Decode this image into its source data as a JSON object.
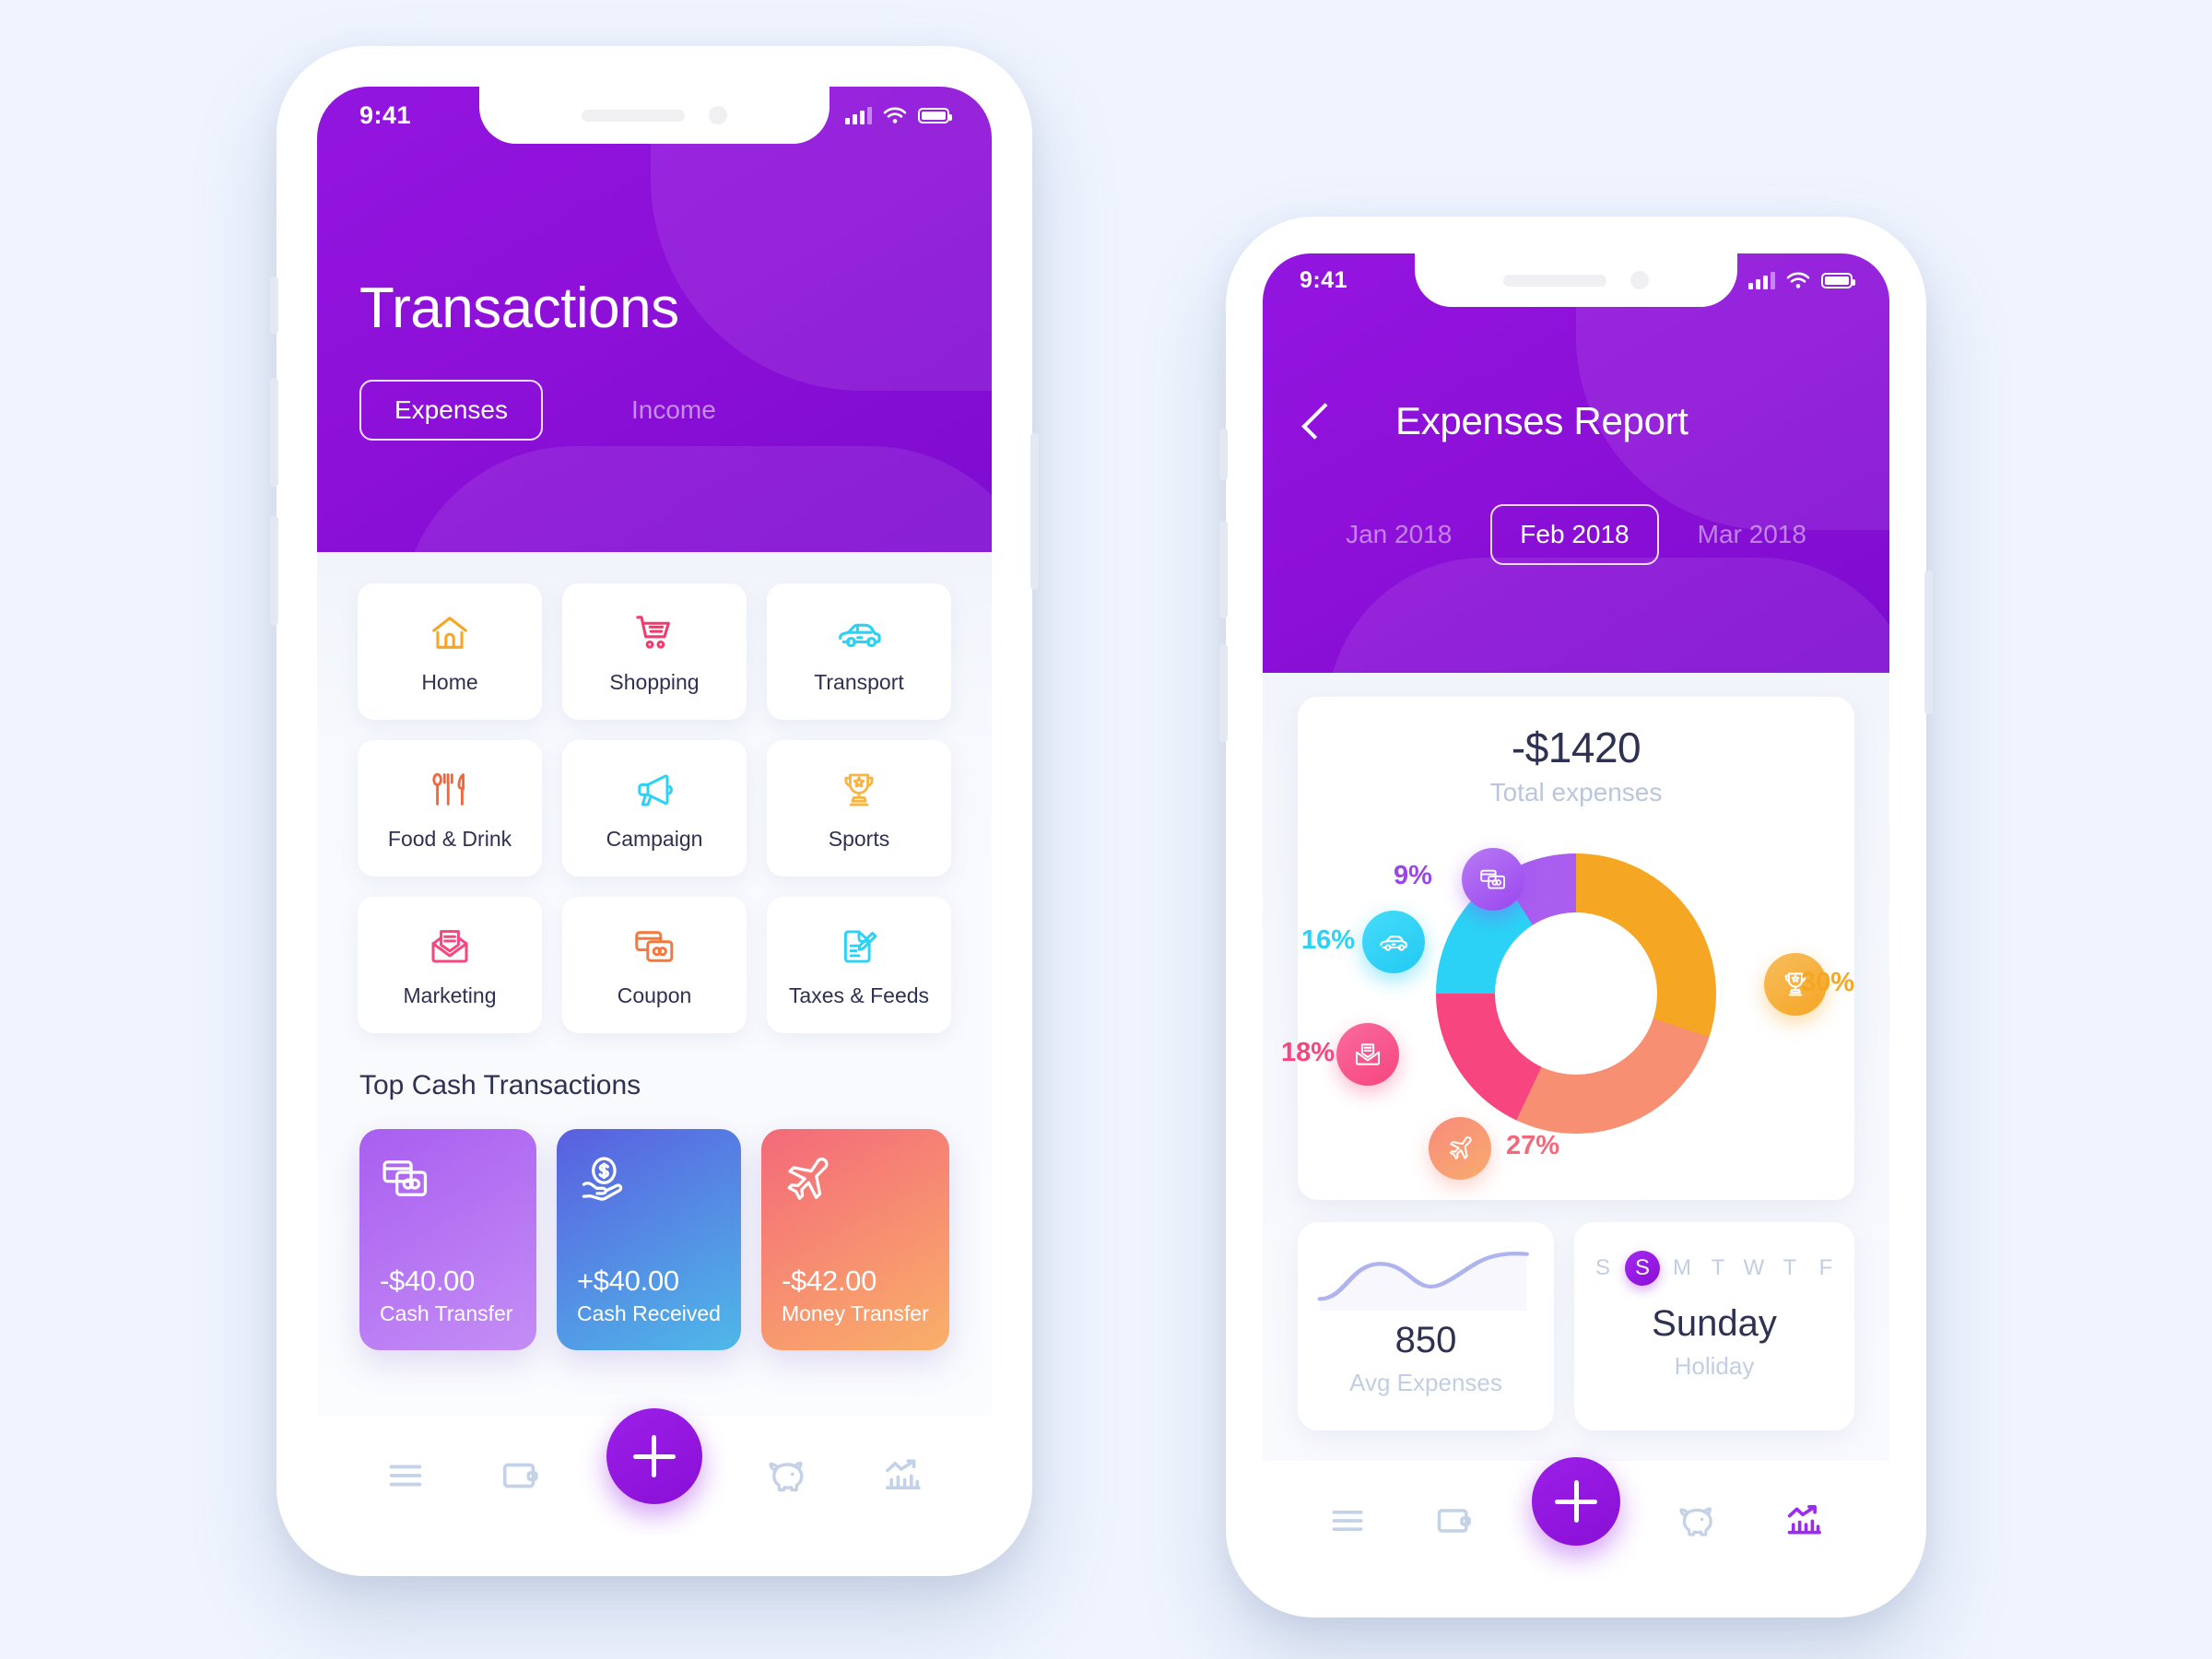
{
  "background_color": "#eff4fe",
  "brand": {
    "purple": "#8a0fd6",
    "purple_light": "#a428ef",
    "text_dark": "#2e3151",
    "text_muted": "#b9c6dd"
  },
  "phone_transactions": {
    "status_bar": {
      "time": "9:41",
      "signal_icon": "signal-bars-icon",
      "wifi_icon": "wifi-icon",
      "battery_icon": "battery-icon"
    },
    "header": {
      "title": "Transactions",
      "tabs": [
        {
          "label": "Expenses",
          "selected": true
        },
        {
          "label": "Income",
          "selected": false
        }
      ]
    },
    "categories": [
      {
        "label": "Home",
        "icon": "house-icon",
        "color": "#f5a623"
      },
      {
        "label": "Shopping",
        "icon": "shopping-cart-icon",
        "color": "#f7386f"
      },
      {
        "label": "Transport",
        "icon": "car-icon",
        "color": "#2bd2f5"
      },
      {
        "label": "Food & Drink",
        "icon": "cutlery-icon",
        "color": "#f4663c"
      },
      {
        "label": "Campaign",
        "icon": "megaphone-icon",
        "color": "#2bd2f5"
      },
      {
        "label": "Sports",
        "icon": "trophy-icon",
        "color": "#f7b548"
      },
      {
        "label": "Marketing",
        "icon": "envelope-icon",
        "color": "#f7457f"
      },
      {
        "label": "Coupon",
        "icon": "credit-cards-icon",
        "color": "#f4783c"
      },
      {
        "label": "Taxes & Feeds",
        "icon": "document-edit-icon",
        "color": "#2bd2f5"
      }
    ],
    "section_title": "Top Cash Transactions",
    "transactions": [
      {
        "amount": "-$40.00",
        "label": "Cash Transfer",
        "icon": "credit-cards-icon",
        "gradient_from": "#a95ef0",
        "gradient_to": "#c48ef5"
      },
      {
        "amount": "+$40.00",
        "label": "Cash Received",
        "icon": "money-hand-icon",
        "gradient_from": "#5a5ee0",
        "gradient_to": "#4fb9e8"
      },
      {
        "amount": "-$42.00",
        "label": "Money Transfer",
        "icon": "airplane-icon",
        "gradient_from": "#f4697a",
        "gradient_to": "#f9b069"
      }
    ],
    "tab_bar": {
      "items": [
        {
          "icon": "menu-icon",
          "active": false
        },
        {
          "icon": "wallet-icon",
          "active": false
        },
        {
          "icon": "plus-icon",
          "active": false,
          "is_fab": true
        },
        {
          "icon": "piggy-bank-icon",
          "active": false
        },
        {
          "icon": "chart-growth-icon",
          "active": false
        }
      ]
    }
  },
  "phone_report": {
    "status_bar": {
      "time": "9:41",
      "signal_icon": "signal-bars-icon",
      "wifi_icon": "wifi-icon",
      "battery_icon": "battery-icon"
    },
    "header": {
      "back_icon": "chevron-left-icon",
      "title": "Expenses Report",
      "months": [
        {
          "label": "Jan 2018",
          "selected": false
        },
        {
          "label": "Feb 2018",
          "selected": true
        },
        {
          "label": "Mar 2018",
          "selected": false
        }
      ]
    },
    "summary": {
      "total": "-$1420",
      "caption": "Total expenses"
    },
    "stats": [
      {
        "value": "850",
        "caption": "Avg Expenses",
        "icon": "sparkline-wave-icon"
      },
      {
        "value": "Sunday",
        "caption": "Holiday",
        "days": [
          "S",
          "S",
          "M",
          "T",
          "W",
          "T",
          "F"
        ],
        "selected_day_index": 1
      }
    ],
    "tab_bar": {
      "items": [
        {
          "icon": "menu-icon",
          "active": false
        },
        {
          "icon": "wallet-icon",
          "active": false
        },
        {
          "icon": "plus-icon",
          "active": false,
          "is_fab": true
        },
        {
          "icon": "piggy-bank-icon",
          "active": false
        },
        {
          "icon": "chart-growth-icon",
          "active": true
        }
      ]
    }
  },
  "chart_data": {
    "type": "pie",
    "title": "Total expenses",
    "total_label": "-$1420",
    "total_value": -1420,
    "units": "percent",
    "categories": [
      "Sports",
      "Travel",
      "Marketing",
      "Transport",
      "Coupon"
    ],
    "values": [
      30,
      27,
      18,
      16,
      9
    ],
    "labels": [
      "30%",
      "27%",
      "18%",
      "16%",
      "9%"
    ],
    "colors": [
      "#f5a623",
      "#f79072",
      "#f7457f",
      "#2bd2f5",
      "#a95ef0"
    ],
    "icons": [
      "trophy-icon",
      "airplane-icon",
      "envelope-icon",
      "car-icon",
      "credit-cards-icon"
    ],
    "legend": "bubbles-around-donut",
    "donut": true,
    "inner_radius_ratio": 0.58,
    "start_angle_deg": 0,
    "direction": "clockwise",
    "grid": false
  }
}
